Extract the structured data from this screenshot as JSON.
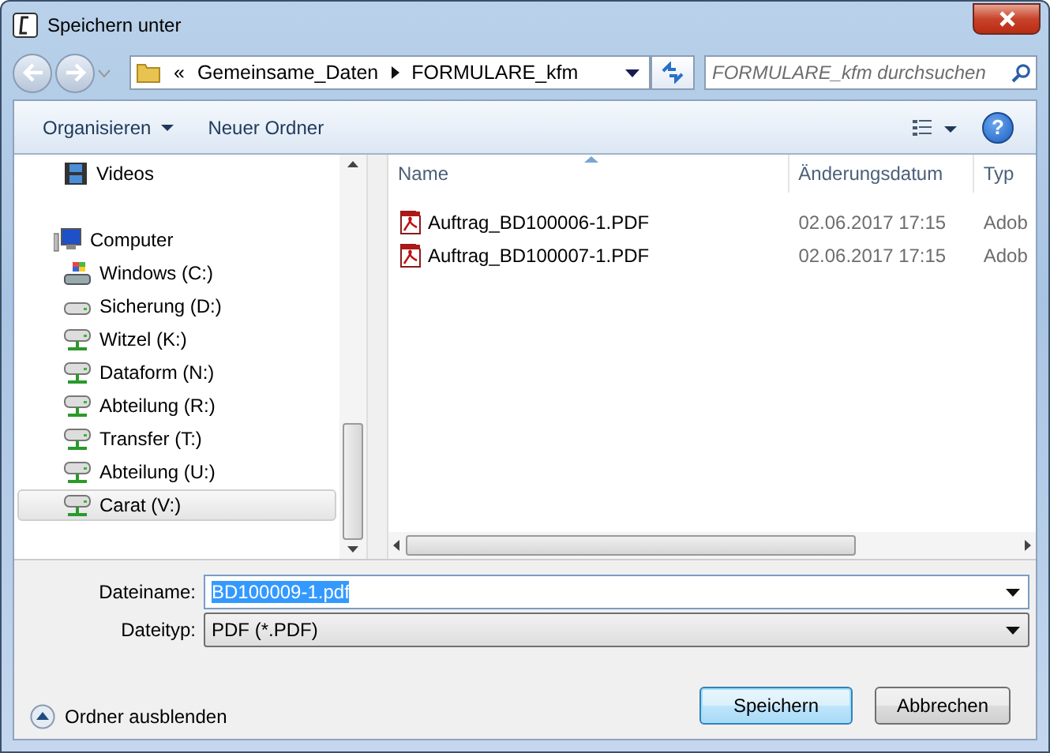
{
  "window": {
    "title": "Speichern unter"
  },
  "address": {
    "overflow": "«",
    "path": [
      "Gemeinsame_Daten",
      "FORMULARE_kfm"
    ]
  },
  "search": {
    "placeholder": "FORMULARE_kfm durchsuchen"
  },
  "toolbar": {
    "organize": "Organisieren",
    "new_folder": "Neuer Ordner",
    "help": "?"
  },
  "sidebar": {
    "items": [
      {
        "label": "Videos",
        "kind": "videos",
        "selected": false
      },
      {
        "label": "Computer",
        "kind": "computer",
        "selected": false,
        "children": [
          {
            "label": "Windows (C:)",
            "kind": "system-drive",
            "selected": false
          },
          {
            "label": "Sicherung (D:)",
            "kind": "drive",
            "selected": false
          },
          {
            "label": "Witzel (K:)",
            "kind": "network",
            "selected": false
          },
          {
            "label": "Dataform (N:)",
            "kind": "network",
            "selected": false
          },
          {
            "label": "Abteilung (R:)",
            "kind": "network",
            "selected": false
          },
          {
            "label": "Transfer (T:)",
            "kind": "network",
            "selected": false
          },
          {
            "label": "Abteilung (U:)",
            "kind": "network",
            "selected": false
          },
          {
            "label": "Carat (V:)",
            "kind": "network",
            "selected": true
          }
        ]
      }
    ]
  },
  "files": {
    "columns": [
      "Name",
      "Änderungsdatum",
      "Typ"
    ],
    "rows": [
      {
        "name": "Auftrag_BD100006-1.PDF",
        "date": "02.06.2017 17:15",
        "type": "Adob"
      },
      {
        "name": "Auftrag_BD100007-1.PDF",
        "date": "02.06.2017 17:15",
        "type": "Adob"
      }
    ]
  },
  "form": {
    "filename_label": "Dateiname:",
    "filename": "BD100009-1.pdf",
    "filename_selected": true,
    "filetype_label": "Dateityp:",
    "filetype": "PDF (*.PDF)"
  },
  "hide_folders": "Ordner ausblenden",
  "buttons": [
    {
      "label": "Speichern",
      "default": true
    },
    {
      "label": "Abbrechen",
      "default": false
    }
  ]
}
